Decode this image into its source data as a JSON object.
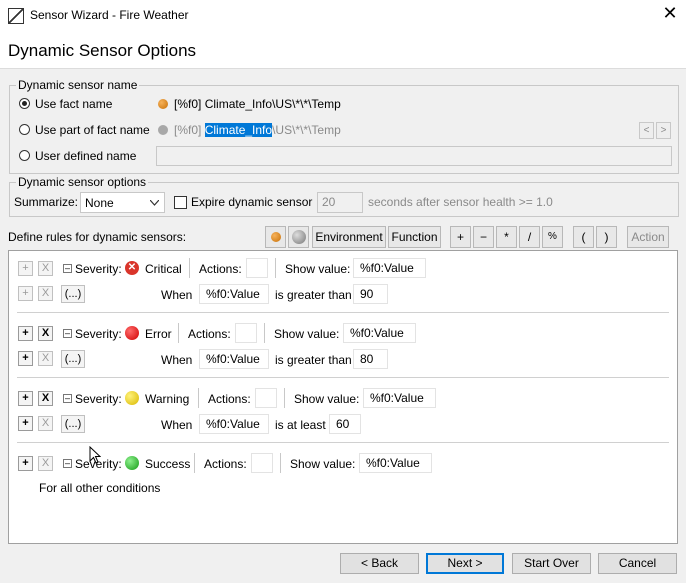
{
  "window": {
    "title": "Sensor Wizard - Fire Weather",
    "close_glyph": "✕"
  },
  "page": {
    "title": "Dynamic Sensor Options"
  },
  "name_group": {
    "legend": "Dynamic sensor name",
    "opt_fact": "Use fact name",
    "fact_prefix": "[%f0]",
    "fact_value": "Climate_Info\\US\\*\\*\\Temp",
    "opt_part": "Use part of fact name",
    "part_prefix": "[%f0]",
    "part_selected": "Climate_Info",
    "part_rest": "\\US\\*\\*\\Temp",
    "part_left": "<",
    "part_right": ">",
    "opt_user": "User defined name",
    "user_value": ""
  },
  "options_group": {
    "legend": "Dynamic sensor options",
    "summarize_label": "Summarize:",
    "summarize_value": "None",
    "expire_label": "Expire dynamic sensor",
    "seconds_value": "20",
    "seconds_label": "seconds after sensor health >= 1.0"
  },
  "rules_header": {
    "label": "Define rules for dynamic sensors:"
  },
  "toolbar": {
    "environment": "Environment",
    "function": "Function",
    "plus": "+",
    "minus": "−",
    "times": "*",
    "divide": "/",
    "percent": "%",
    "lparen": "(",
    "rparen": ")",
    "action": "Action"
  },
  "rules": [
    {
      "severity_label": "Severity:",
      "severity": "Critical",
      "color": "#d9352b",
      "actions_label": "Actions:",
      "show_label": "Show value:",
      "show_value": "%f0:Value",
      "when_label": "When",
      "when_value": "%f0:Value",
      "operator": "is greater than",
      "threshold": "90"
    },
    {
      "severity_label": "Severity:",
      "severity": "Error",
      "color": "#e51c1c",
      "actions_label": "Actions:",
      "show_label": "Show value:",
      "show_value": "%f0:Value",
      "when_label": "When",
      "when_value": "%f0:Value",
      "operator": "is greater than",
      "threshold": "80"
    },
    {
      "severity_label": "Severity:",
      "severity": "Warning",
      "color": "#f2d600",
      "actions_label": "Actions:",
      "show_label": "Show value:",
      "show_value": "%f0:Value",
      "when_label": "When",
      "when_value": "%f0:Value",
      "operator": "is at least",
      "threshold": "60"
    },
    {
      "severity_label": "Severity:",
      "severity": "Success",
      "color": "#2fb52f",
      "actions_label": "Actions:",
      "show_label": "Show value:",
      "show_value": "%f0:Value",
      "other_label": "For all other conditions"
    }
  ],
  "rule_buttons": {
    "add": "+",
    "remove": "X",
    "group": "(...)"
  },
  "footer": {
    "back": "< Back",
    "next": "Next >",
    "start_over": "Start Over",
    "cancel": "Cancel"
  }
}
